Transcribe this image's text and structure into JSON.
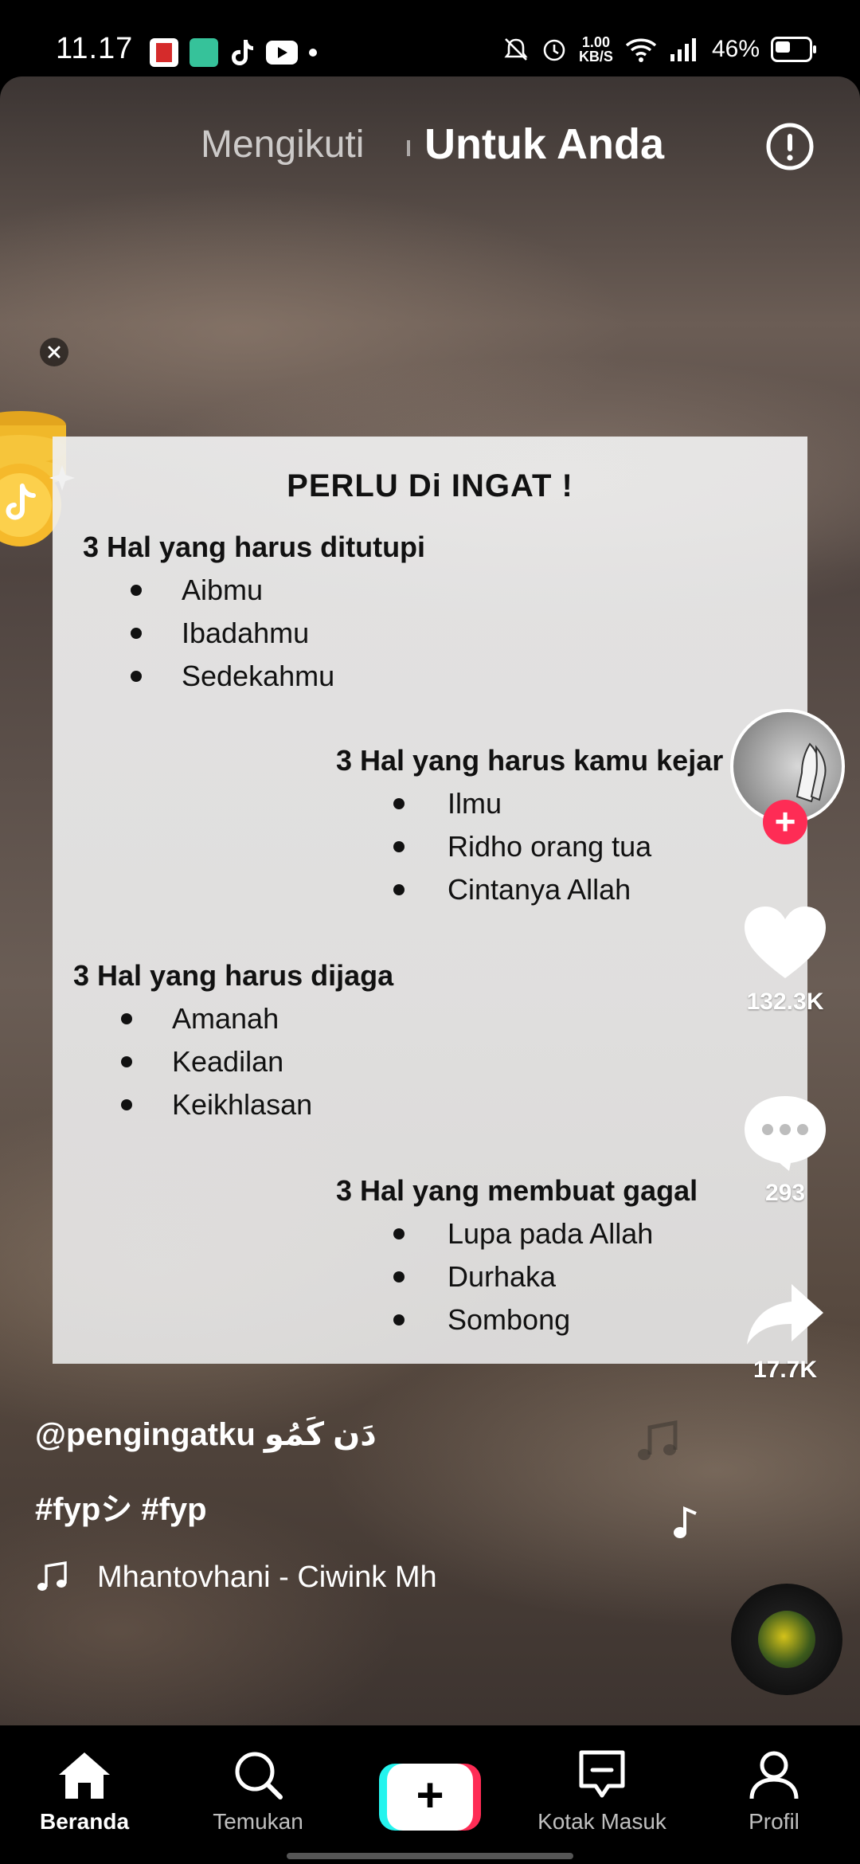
{
  "status_bar": {
    "time": "11.17",
    "net_speed_value": "1.00",
    "net_speed_unit": "KB/S",
    "battery_percent": "46%"
  },
  "top_tabs": {
    "following": "Mengikuti",
    "for_you": "Untuk Anda"
  },
  "slide": {
    "title": "PERLU  Di INGAT !",
    "sections": [
      {
        "heading": "3 Hal yang harus ditutupi",
        "items": [
          "Aibmu",
          "Ibadahmu",
          "Sedekahmu"
        ]
      },
      {
        "heading": "3 Hal yang harus kamu kejar",
        "items": [
          "Ilmu",
          "Ridho orang tua",
          "Cintanya Allah"
        ]
      },
      {
        "heading": "3 Hal yang harus dijaga",
        "items": [
          "Amanah",
          "Keadilan",
          "Keikhlasan"
        ]
      },
      {
        "heading": "3 Hal yang membuat gagal",
        "items": [
          "Lupa pada Allah",
          "Durhaka",
          "Sombong"
        ]
      }
    ]
  },
  "rail": {
    "like_count": "132.3K",
    "comment_count": "293",
    "share_count": "17.7K"
  },
  "caption": {
    "username": "@pengingatku دَن كَمُو",
    "hashtags": "#fypシ #fyp",
    "music": "Mhantovhani - Ciwink Mh"
  },
  "bottom_nav": {
    "home": "Beranda",
    "discover": "Temukan",
    "inbox": "Kotak Masuk",
    "profile": "Profil"
  },
  "colors": {
    "accent": "#fe2c55",
    "cyan": "#25f4ee"
  }
}
